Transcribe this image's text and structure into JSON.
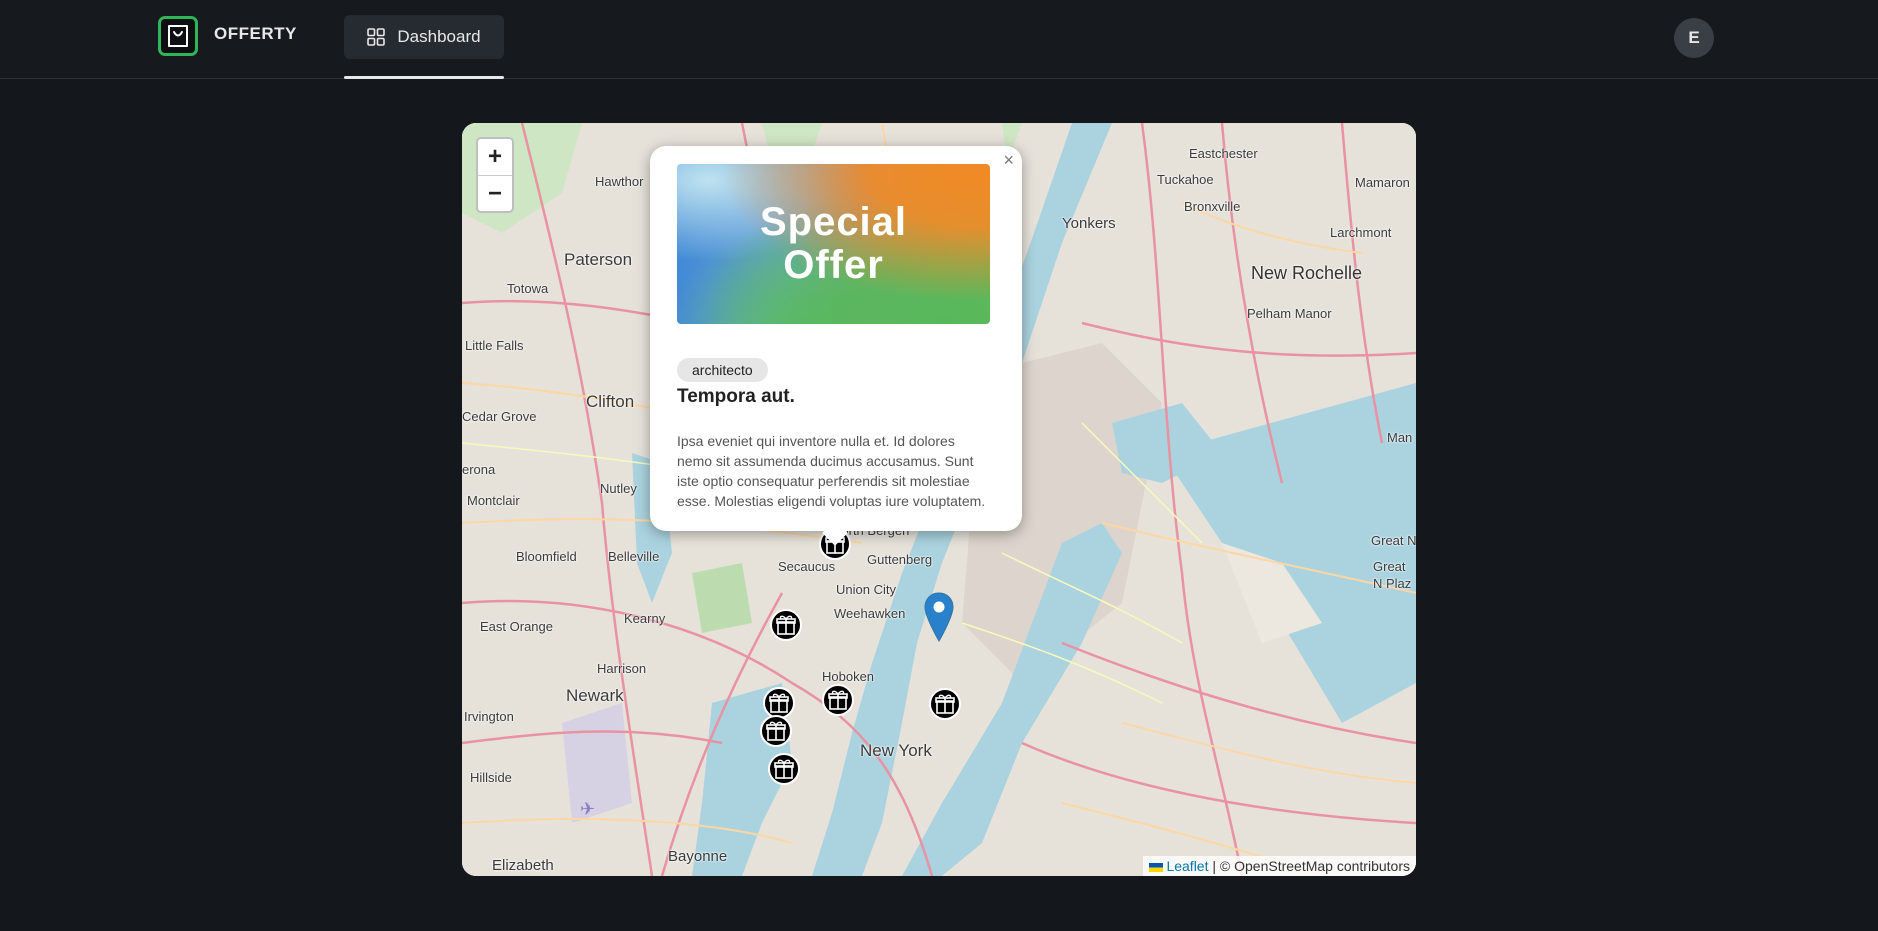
{
  "header": {
    "brand_name": "OFFERTY",
    "nav_tab_label": "Dashboard",
    "avatar_initial": "E"
  },
  "map": {
    "zoom_in_label": "+",
    "zoom_out_label": "−",
    "attribution_link": "Leaflet",
    "attribution_text": " | © OpenStreetMap contributors",
    "places": {
      "paterson": "Paterson",
      "totowa": "Totowa",
      "hawthorne": "Hawthor",
      "little_falls": "Little Falls",
      "clifton": "Clifton",
      "cedar_grove": "Cedar Grove",
      "verona": "erona",
      "montclair": "Montclair",
      "nutley": "Nutley",
      "bloomfield": "Bloomfield",
      "belleville": "Belleville",
      "east_orange": "East Orange",
      "kearny": "Kearny",
      "harrison": "Harrison",
      "newark": "Newark",
      "irvington": "Irvington",
      "hillside": "Hillside",
      "elizabeth": "Elizabeth",
      "bayonne": "Bayonne",
      "secaucus": "Secaucus",
      "north_bergen": "North Bergen",
      "guttenberg": "Guttenberg",
      "union_city": "Union City",
      "weehawken": "Weehawken",
      "hoboken": "Hoboken",
      "new_york": "New York",
      "yonkers": "Yonkers",
      "eastchester": "Eastchester",
      "tuckahoe": "Tuckahoe",
      "bronxville": "Bronxville",
      "larchmont": "Larchmont",
      "mamaroneck": "Mamaron",
      "new_rochelle": "New Rochelle",
      "pelham_manor": "Pelham Manor",
      "great_neck": "Great N",
      "great_neck_plaza": "Great N Plaz",
      "man": "Man"
    }
  },
  "popup": {
    "close_label": "×",
    "image_text": "Special Offer",
    "category": "architecto",
    "title": "Tempora aut.",
    "description": "Ipsa eveniet qui inventore nulla et. Id dolores nemo sit assumenda ducimus accusamus. Sunt iste optio consequatur perferendis sit molestiae esse. Molestias eligendi voluptas iure voluptatem."
  },
  "colors": {
    "background": "#14171c",
    "brand_green": "#2fb559",
    "marker_blue": "#2a81cb",
    "link_blue": "#0078a8"
  },
  "icons": [
    "shopping-bag-icon",
    "grid-icon",
    "gift-marker-icon",
    "location-pin-icon",
    "close-icon"
  ]
}
